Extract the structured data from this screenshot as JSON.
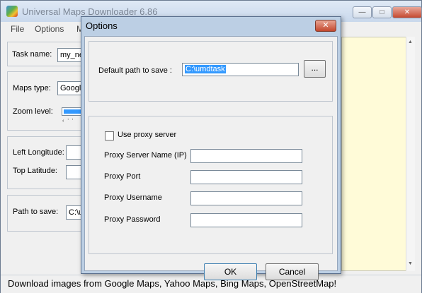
{
  "app": {
    "title": "Universal Maps Downloader 6.86",
    "menu": [
      "File",
      "Options",
      "M"
    ],
    "window_buttons": [
      "minimize-icon",
      "maximize-icon",
      "close-icon"
    ]
  },
  "main": {
    "task_name_label": "Task name:",
    "task_name_value": "my_ne",
    "maps_type_label": "Maps type:",
    "maps_type_value": "Google",
    "zoom_level_label": "Zoom level:",
    "left_longitude_label": "Left Longitude:",
    "top_latitude_label": "Top Latitude:",
    "path_label": "Path to save:",
    "path_value": "C:\\u"
  },
  "status_text": "Download images from Google Maps, Yahoo Maps, Bing Maps, OpenStreetMap!",
  "dialog": {
    "title": "Options",
    "default_path_label": "Default path to save :",
    "default_path_value": "C:\\umdtask",
    "browse_label": "...",
    "use_proxy_label": "Use proxy server",
    "use_proxy_checked": false,
    "proxy_server_label": "Proxy Server Name (IP)",
    "proxy_port_label": "Proxy Port",
    "proxy_username_label": "Proxy Username",
    "proxy_password_label": "Proxy Password",
    "proxy_server_value": "",
    "proxy_port_value": "",
    "proxy_username_value": "",
    "proxy_password_value": "",
    "ok_label": "OK",
    "cancel_label": "Cancel"
  }
}
